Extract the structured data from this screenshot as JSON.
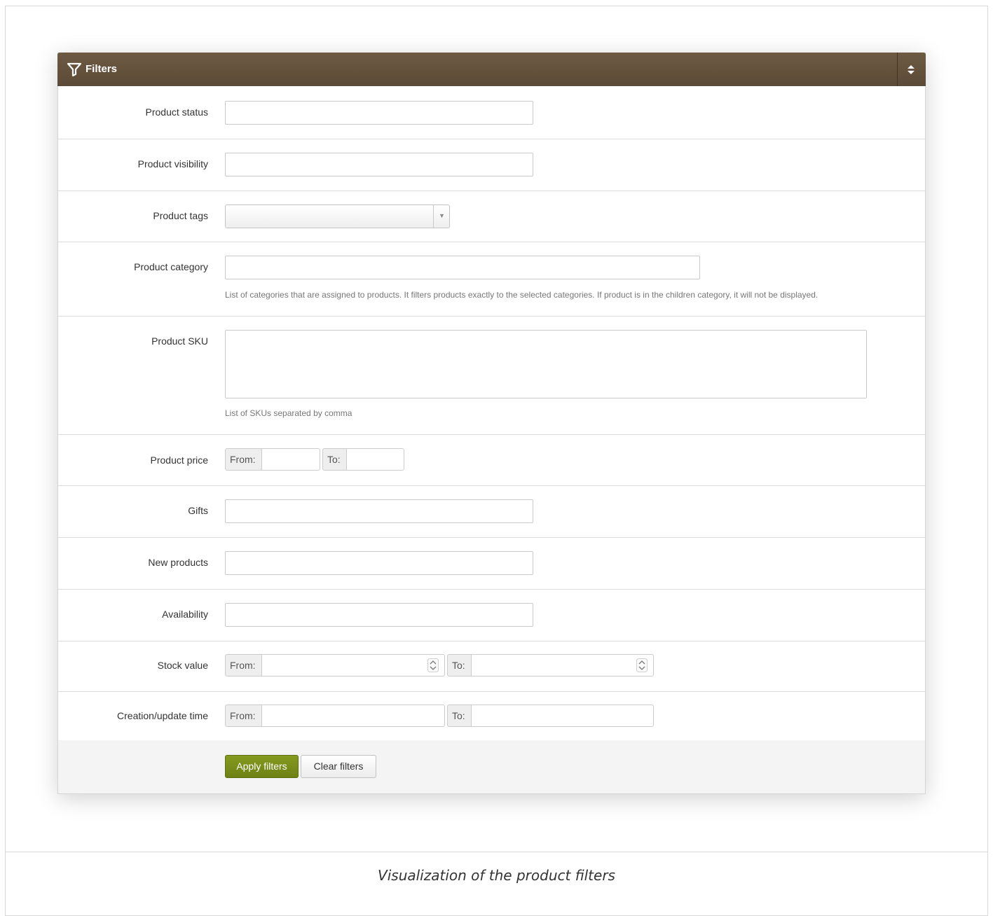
{
  "panel": {
    "title": "Filters",
    "icons": {
      "filter": "filter-icon",
      "toggle": "sort-toggle-icon"
    }
  },
  "fields": {
    "product_status": {
      "label": "Product status",
      "value": ""
    },
    "product_visibility": {
      "label": "Product visibility",
      "value": ""
    },
    "product_tags": {
      "label": "Product tags",
      "value": ""
    },
    "product_category": {
      "label": "Product category",
      "value": "",
      "hint": "List of categories that are assigned to products. It filters products exactly to the selected categories. If product is in the children category, it will not be displayed."
    },
    "product_sku": {
      "label": "Product SKU",
      "value": "",
      "hint": "List of SKUs separated by comma"
    },
    "product_price": {
      "label": "Product price",
      "from_label": "From:",
      "to_label": "To:",
      "from_value": "",
      "to_value": ""
    },
    "gifts": {
      "label": "Gifts",
      "value": ""
    },
    "new_products": {
      "label": "New products",
      "value": ""
    },
    "availability": {
      "label": "Availability",
      "value": ""
    },
    "stock_value": {
      "label": "Stock value",
      "from_label": "From:",
      "to_label": "To:",
      "from_value": "",
      "to_value": ""
    },
    "creation_update_time": {
      "label": "Creation/update time",
      "from_label": "From:",
      "to_label": "To:",
      "from_value": "",
      "to_value": ""
    }
  },
  "buttons": {
    "apply": "Apply filters",
    "clear": "Clear filters"
  },
  "caption": "Visualization of the product filters",
  "colors": {
    "header": "#5e4d39",
    "apply_button": "#78891a"
  }
}
